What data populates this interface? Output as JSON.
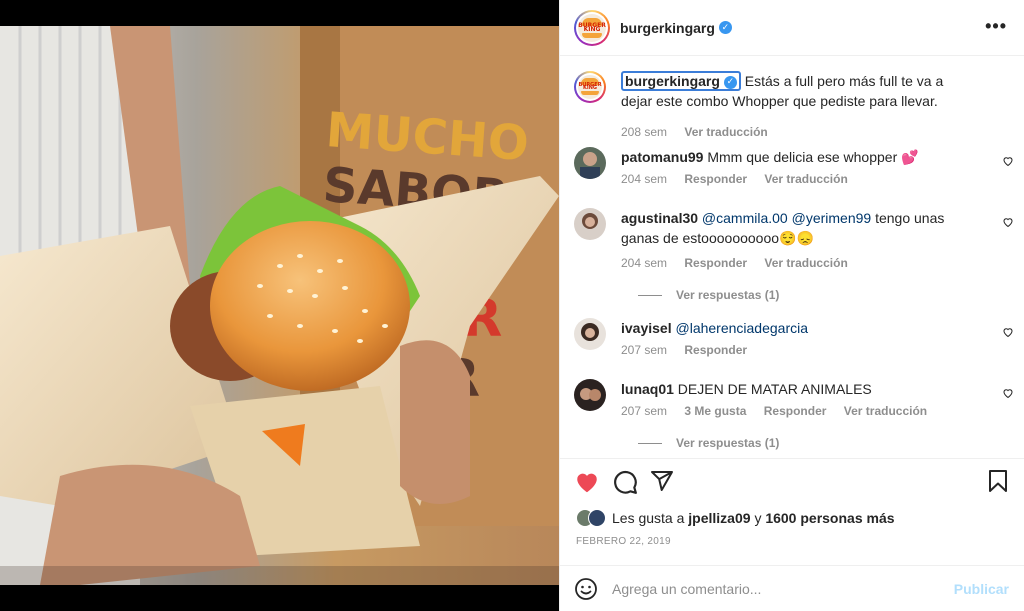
{
  "post": {
    "username": "burgerkingarg",
    "verified_icon": "verified-badge-icon",
    "more_icon": "more-options-icon"
  },
  "photo": {
    "bag_text_1": "MUCHO",
    "bag_text_2": "SABOR",
    "bag_text_3": "UR",
    "bag_text_4": "R"
  },
  "caption": {
    "username": "burgerkingarg",
    "text": "Estás a full pero más full te va a dejar este combo Whopper que pediste para llevar.",
    "time": "208 sem",
    "translate": "Ver traducción"
  },
  "comments": [
    {
      "username": "patomanu99",
      "text": "Mmm que delicia ese whopper 💕",
      "time": "204 sem",
      "reply": "Responder",
      "translate": "Ver traducción"
    },
    {
      "username": "agustinal30",
      "mention1": "@cammila.00",
      "mention2": "@yerimen99",
      "text": "tengo unas ganas de estoooooooooo😌😞",
      "time": "204 sem",
      "reply": "Responder",
      "translate": "Ver traducción",
      "replies": "Ver respuestas (1)"
    },
    {
      "username": "ivayisel",
      "mention1": "@laherenciadegarcia",
      "time": "207 sem",
      "reply": "Responder"
    },
    {
      "username": "lunaq01",
      "text": "DEJEN DE MATAR ANIMALES",
      "time": "207 sem",
      "likes": "3 Me gusta",
      "reply": "Responder",
      "translate": "Ver traducción",
      "replies": "Ver respuestas (1)"
    }
  ],
  "actions": {
    "like_prefix": "Les gusta a",
    "like_user": "jpelliza09",
    "like_join": "y",
    "like_count": "1600 personas más",
    "date": "Febrero 22, 2019"
  },
  "add_comment": {
    "placeholder": "Agrega un comentario...",
    "publish": "Publicar"
  },
  "colors": {
    "heart_red": "#ed4956",
    "link_blue": "#00376b",
    "verified_blue": "#3897f0"
  }
}
